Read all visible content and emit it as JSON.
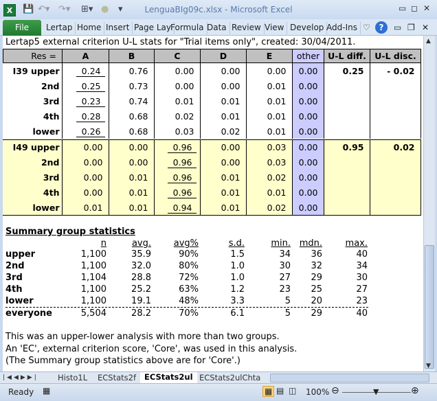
{
  "window": {
    "title": "LenguaBIg09c.xlsx - Microsoft Excel"
  },
  "ribbon": {
    "file": "File",
    "tabs": [
      "Lertap",
      "Home",
      "Insert",
      "Page Lay",
      "Formula",
      "Data",
      "Review",
      "View",
      "Develop",
      "Add-Ins"
    ]
  },
  "sheet": {
    "caption": "Lertap5 external criterion U-L stats for \"Trial items only\", created: 30/04/2011.",
    "headers": [
      "Res =",
      "A",
      "B",
      "C",
      "D",
      "E",
      "other",
      "U-L diff.",
      "U-L disc."
    ],
    "items": [
      {
        "name": "I39",
        "key_index": 0,
        "ul_diff": "0.25",
        "ul_disc": "- 0.02",
        "highlight": false,
        "rows": [
          {
            "label": "I39 upper",
            "values": [
              "0.24",
              "0.76",
              "0.00",
              "0.00",
              "0.00",
              "0.00"
            ]
          },
          {
            "label": "2nd",
            "values": [
              "0.25",
              "0.73",
              "0.00",
              "0.00",
              "0.01",
              "0.00"
            ]
          },
          {
            "label": "3rd",
            "values": [
              "0.23",
              "0.74",
              "0.01",
              "0.01",
              "0.01",
              "0.00"
            ]
          },
          {
            "label": "4th",
            "values": [
              "0.28",
              "0.68",
              "0.02",
              "0.01",
              "0.01",
              "0.00"
            ]
          },
          {
            "label": "lower",
            "values": [
              "0.26",
              "0.68",
              "0.03",
              "0.02",
              "0.01",
              "0.00"
            ]
          }
        ]
      },
      {
        "name": "I49",
        "key_index": 2,
        "ul_diff": "0.95",
        "ul_disc": "0.02",
        "highlight": true,
        "rows": [
          {
            "label": "I49 upper",
            "values": [
              "0.00",
              "0.00",
              "0.96",
              "0.00",
              "0.03",
              "0.00"
            ]
          },
          {
            "label": "2nd",
            "values": [
              "0.00",
              "0.00",
              "0.96",
              "0.00",
              "0.03",
              "0.00"
            ]
          },
          {
            "label": "3rd",
            "values": [
              "0.00",
              "0.01",
              "0.96",
              "0.01",
              "0.02",
              "0.00"
            ]
          },
          {
            "label": "4th",
            "values": [
              "0.00",
              "0.01",
              "0.96",
              "0.01",
              "0.01",
              "0.00"
            ]
          },
          {
            "label": "lower",
            "values": [
              "0.01",
              "0.01",
              "0.94",
              "0.01",
              "0.02",
              "0.00"
            ]
          }
        ]
      }
    ],
    "summary": {
      "title": "Summary group statistics",
      "headers": [
        "n",
        "avg.",
        "avg%",
        "s.d.",
        "min.",
        "mdn.",
        "max."
      ],
      "rows": [
        {
          "label": "upper",
          "values": [
            "1,100",
            "35.9",
            "90%",
            "1.5",
            "34",
            "36",
            "40"
          ]
        },
        {
          "label": "2nd",
          "values": [
            "1,100",
            "32.0",
            "80%",
            "1.0",
            "30",
            "32",
            "34"
          ]
        },
        {
          "label": "3rd",
          "values": [
            "1,104",
            "28.8",
            "72%",
            "1.0",
            "27",
            "29",
            "30"
          ]
        },
        {
          "label": "4th",
          "values": [
            "1,100",
            "25.2",
            "63%",
            "1.2",
            "23",
            "25",
            "27"
          ]
        },
        {
          "label": "lower",
          "values": [
            "1,100",
            "19.1",
            "48%",
            "3.3",
            "5",
            "20",
            "23"
          ]
        },
        {
          "label": "everyone",
          "values": [
            "5,504",
            "28.2",
            "70%",
            "6.1",
            "5",
            "29",
            "40"
          ]
        }
      ]
    },
    "notes": [
      "This was an upper-lower analysis with more than two groups.",
      "An 'EC', external criterion score, 'Core', was used in this analysis.",
      "(The Summary group statistics above are for 'Core'.)"
    ]
  },
  "sheet_tabs": {
    "tabs": [
      "Histo1L",
      "ECStats2f",
      "ECStats2ul",
      "ECStats2ulChta"
    ],
    "active": "ECStats2ul"
  },
  "status": {
    "ready": "Ready",
    "zoom": "100%",
    "zoom_percent": 100
  },
  "colors": {
    "other_column": "#ccccff",
    "highlight_item": "#ffffcc",
    "header": "#c0c0c0",
    "file_tab": "#2a8a3a"
  }
}
